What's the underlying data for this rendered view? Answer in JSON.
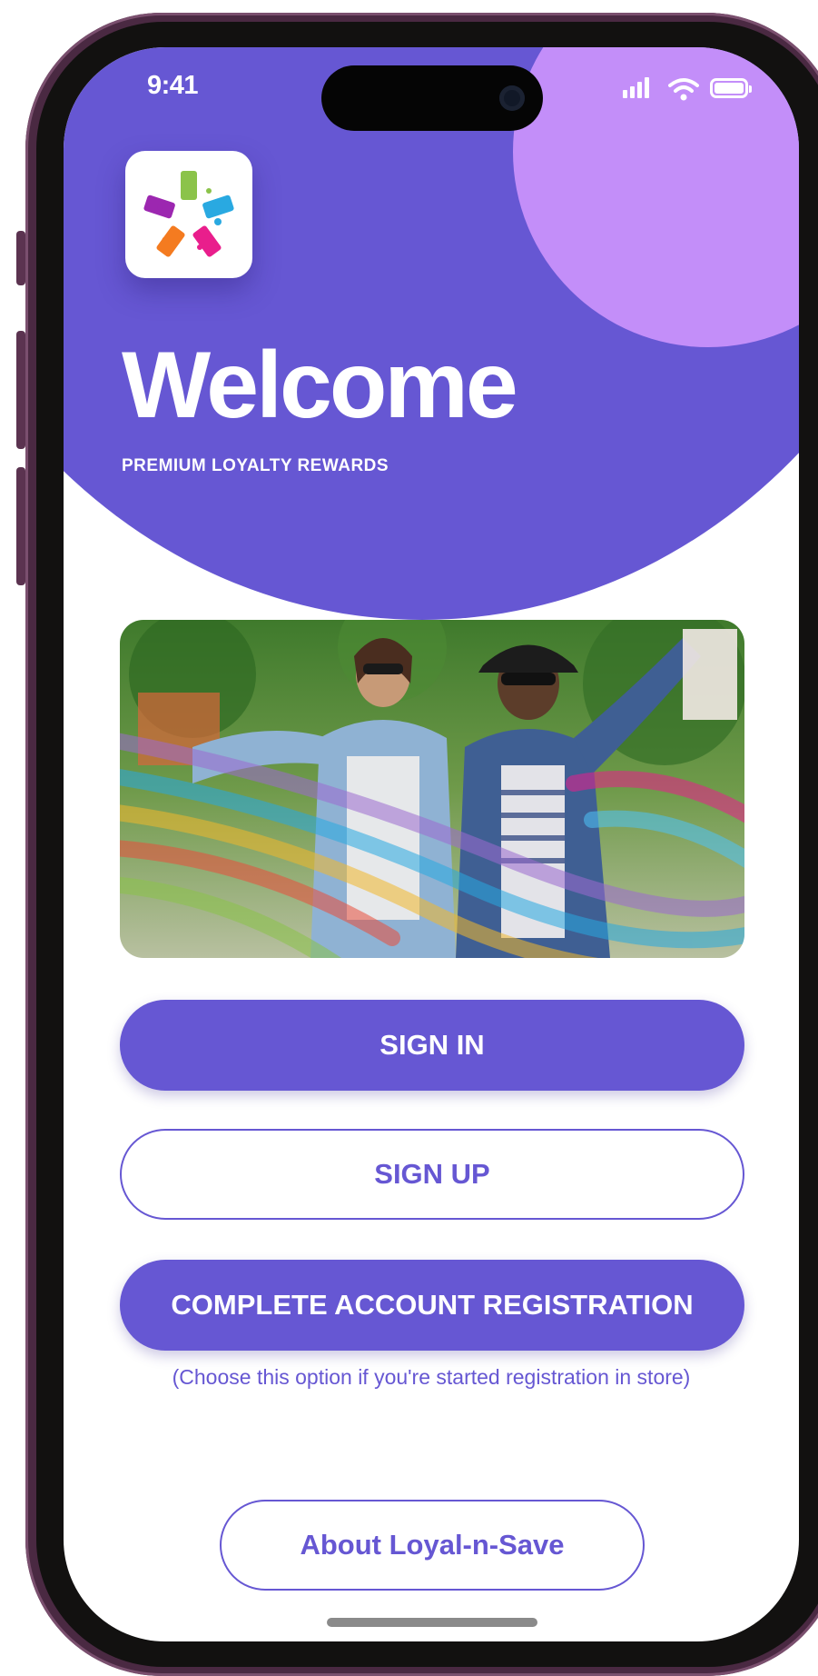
{
  "status_bar": {
    "time": "9:41",
    "signal_icon": "signal-bars-icon",
    "wifi_icon": "wifi-icon",
    "battery_icon": "battery-icon"
  },
  "header": {
    "logo_icon": "shopping-tags-logo-icon",
    "title": "Welcome",
    "tagline": "PREMIUM LOYALTY REWARDS"
  },
  "hero_image": {
    "description_icon": "shopping-friends-photo"
  },
  "actions": {
    "sign_in_label": "SIGN IN",
    "sign_up_label": "SIGN UP",
    "complete_registration_label": "COMPLETE ACCOUNT REGISTRATION",
    "complete_registration_hint": "(Choose this option if you're started registration in store)",
    "about_label": "About Loyal-n-Save"
  },
  "colors": {
    "primary": "#6657d3",
    "accent": "#c38ef9",
    "phone_frame": "#4a2942",
    "background": "#ffffff"
  }
}
